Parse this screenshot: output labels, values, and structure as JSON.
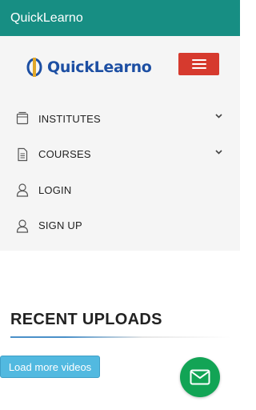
{
  "appbar": {
    "title": "QuickLearno"
  },
  "brand": {
    "logo_text": "QuickLearno"
  },
  "menu": {
    "items": [
      {
        "label": "INSTITUTES",
        "icon": "book-icon",
        "has_chevron": true
      },
      {
        "label": "COURSES",
        "icon": "document-icon",
        "has_chevron": true
      },
      {
        "label": "LOGIN",
        "icon": "user-icon",
        "has_chevron": false
      },
      {
        "label": "SIGN UP",
        "icon": "user-icon",
        "has_chevron": false
      }
    ]
  },
  "recent": {
    "title": "RECENT UPLOADS",
    "load_more_label": "Load more videos"
  },
  "fab": {
    "icon": "mail-icon"
  },
  "colors": {
    "appbar": "#178e83",
    "menu_button": "#d63a2e",
    "brand_blue": "#1d4fa3",
    "load_more": "#52b9e0",
    "fab": "#12a455"
  }
}
